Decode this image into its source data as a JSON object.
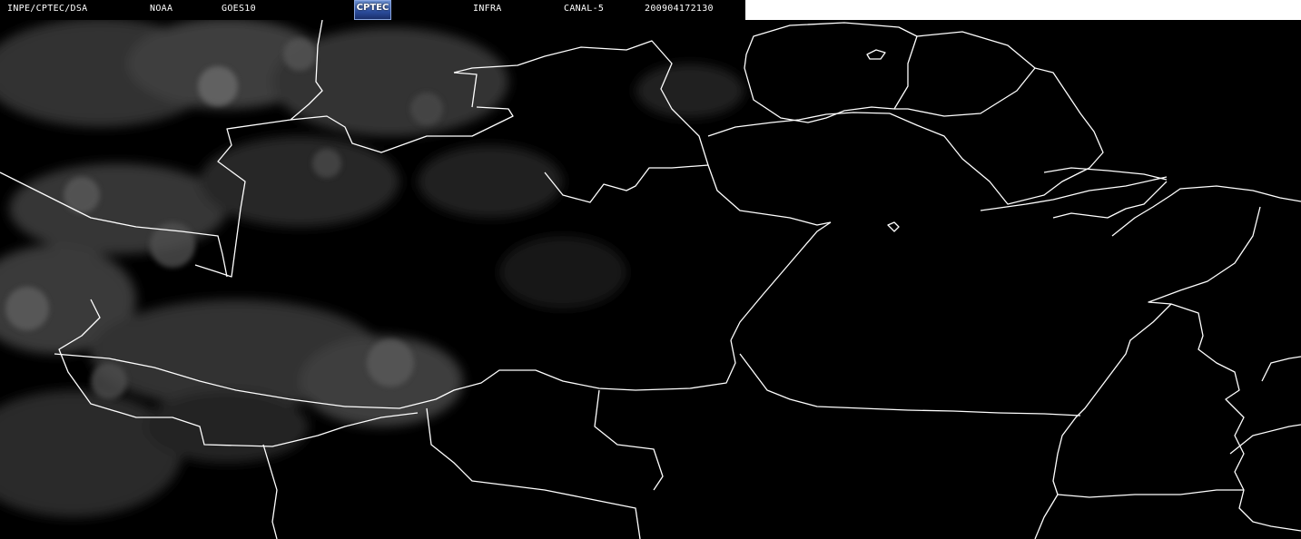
{
  "header": {
    "source": "INPE/CPTEC/DSA",
    "agency": "NOAA",
    "satellite": "GOES10",
    "logo_text": "CPTEC",
    "product": "INFRA",
    "channel": "CANAL-5",
    "timestamp": "200904172130"
  },
  "colors": {
    "background": "#000000",
    "borders": "#ffffff",
    "clouds": "#9a9a9a"
  }
}
